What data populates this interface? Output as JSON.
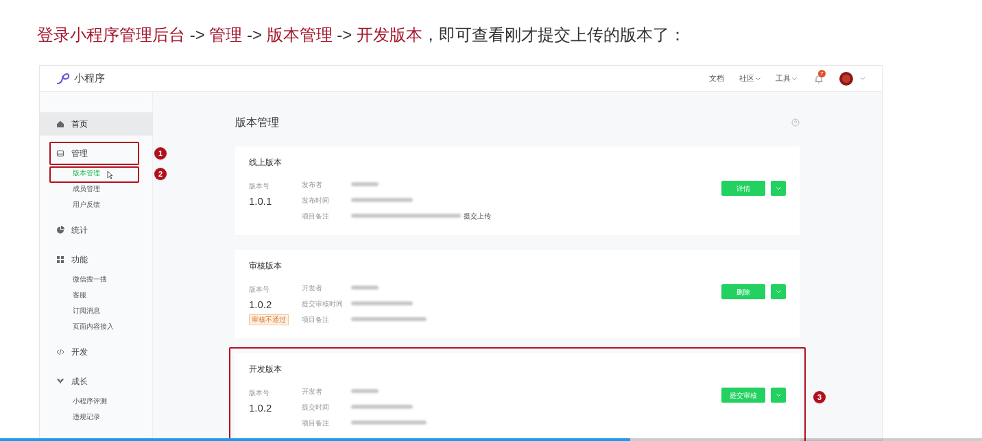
{
  "caption": [
    {
      "text": "登录小程序管理后台",
      "highlight": true
    },
    {
      "text": " -> ",
      "highlight": false
    },
    {
      "text": "管理",
      "highlight": true
    },
    {
      "text": " -> ",
      "highlight": false
    },
    {
      "text": "版本管理",
      "highlight": true
    },
    {
      "text": " -> ",
      "highlight": false
    },
    {
      "text": "开发版本",
      "highlight": true
    },
    {
      "text": "，即可查看刚才提交上传的版本了：",
      "highlight": false
    }
  ],
  "header": {
    "brand": "小程序",
    "links": [
      {
        "label": "文档",
        "dropdown": false
      },
      {
        "label": "社区",
        "dropdown": true
      },
      {
        "label": "工具",
        "dropdown": true
      }
    ],
    "notification_badge": "7"
  },
  "sidebar": {
    "items": [
      {
        "label": "首页",
        "selected": true
      },
      {
        "label": "管理",
        "selected": false,
        "callout": "1",
        "children": [
          {
            "label": "版本管理",
            "selected": true,
            "callout": "2"
          },
          {
            "label": "成员管理",
            "selected": false
          },
          {
            "label": "用户反馈",
            "selected": false
          }
        ]
      },
      {
        "label": "统计",
        "selected": false
      },
      {
        "label": "功能",
        "selected": false,
        "children": [
          {
            "label": "微信搜一搜",
            "selected": false
          },
          {
            "label": "客服",
            "selected": false
          },
          {
            "label": "订阅消息",
            "selected": false
          },
          {
            "label": "页面内容接入",
            "selected": false
          }
        ]
      },
      {
        "label": "开发",
        "selected": false
      },
      {
        "label": "成长",
        "selected": false,
        "children": [
          {
            "label": "小程序评测",
            "selected": false
          },
          {
            "label": "违规记录",
            "selected": false
          }
        ]
      }
    ]
  },
  "main": {
    "title": "版本管理",
    "cards": [
      {
        "title": "线上版本",
        "version_label": "版本号",
        "version": "1.0.1",
        "button": "详情",
        "highlighted": false,
        "fields": [
          {
            "label": "发布者"
          },
          {
            "label": "发布时间"
          },
          {
            "label": "项目备注",
            "suffix": "提交上传"
          }
        ]
      },
      {
        "title": "审核版本",
        "version_label": "版本号",
        "version": "1.0.2",
        "status": "审核不通过",
        "button": "删除",
        "highlighted": false,
        "fields": [
          {
            "label": "开发者"
          },
          {
            "label": "提交审核时间"
          },
          {
            "label": "项目备注"
          }
        ]
      },
      {
        "title": "开发版本",
        "version_label": "版本号",
        "version": "1.0.2",
        "button": "提交审核",
        "highlighted": true,
        "callout": "3",
        "fields": [
          {
            "label": "开发者"
          },
          {
            "label": "提交时间"
          },
          {
            "label": "项目备注"
          }
        ]
      }
    ]
  },
  "player": {
    "level": 0.642
  }
}
